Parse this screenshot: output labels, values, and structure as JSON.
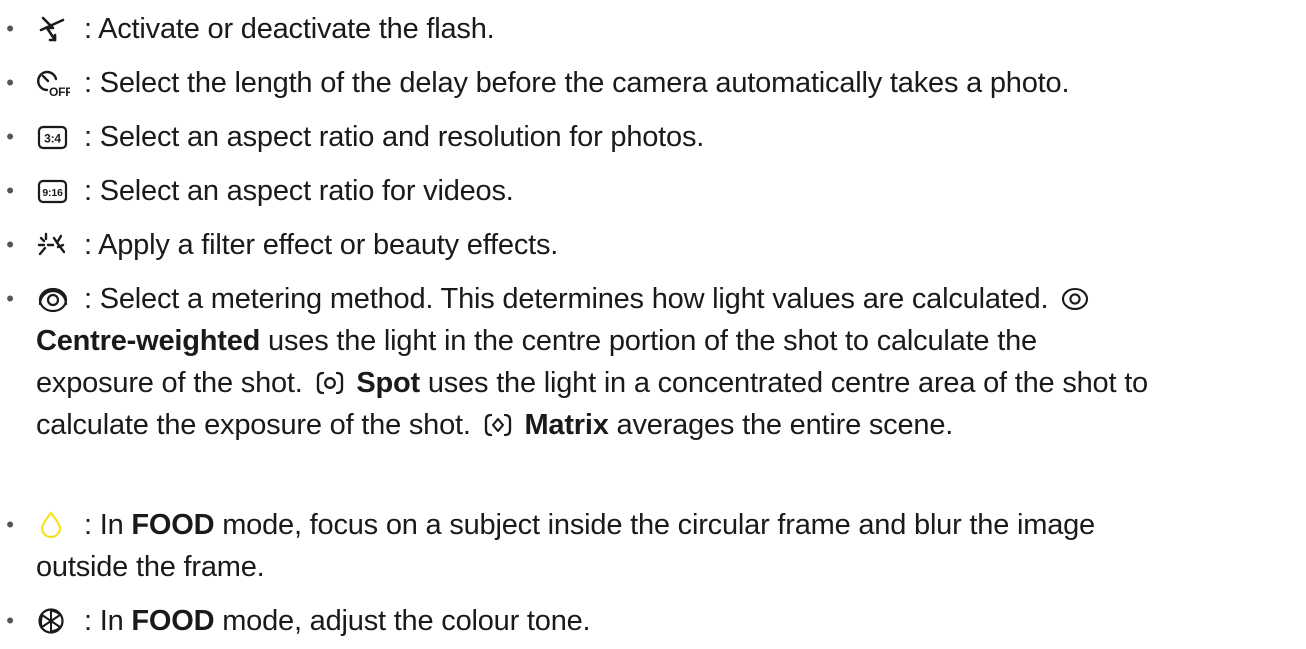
{
  "items": [
    {
      "icon": "flash-off-icon",
      "text": ": Activate or deactivate the flash."
    },
    {
      "icon": "timer-off-icon",
      "text": ": Select the length of the delay before the camera automatically takes a photo."
    },
    {
      "icon": "ratio-3-4-icon",
      "icon_label": "3:4",
      "text": ": Select an aspect ratio and resolution for photos."
    },
    {
      "icon": "ratio-9-16-icon",
      "icon_label": "9:16",
      "text": ": Select an aspect ratio for videos."
    },
    {
      "icon": "filter-effects-icon",
      "text": ": Apply a filter effect or beauty effects."
    },
    {
      "icon": "metering-icon",
      "line1": ": Select a metering method. This determines how light values are calculated.",
      "centre_term": "Centre-weighted",
      "centre_desc": "uses the light in the centre portion of the shot to calculate the",
      "centre_desc2": "exposure of the shot.",
      "spot_term": "Spot",
      "spot_desc": "uses the light in a concentrated centre area of the shot to",
      "spot_desc2": "calculate the exposure of the shot.",
      "matrix_term": "Matrix",
      "matrix_desc": "averages the entire scene."
    },
    {
      "icon": "drop-icon",
      "pre": ": In",
      "term": "FOOD",
      "post": "mode, focus on a subject inside the circular frame and blur the image",
      "line2": "outside the frame."
    },
    {
      "icon": "colour-tone-icon",
      "pre": ": In",
      "term": "FOOD",
      "post": "mode, adjust the colour tone."
    }
  ],
  "colors": {
    "text": "#1a1a1a",
    "drop_icon": "#f2e41c"
  }
}
